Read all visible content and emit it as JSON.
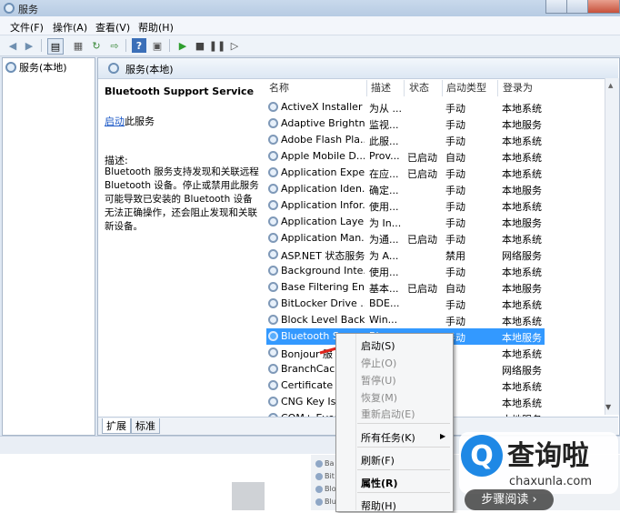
{
  "window": {
    "title": "服务"
  },
  "menu": [
    "文件(F)",
    "操作(A)",
    "查看(V)",
    "帮助(H)"
  ],
  "tree": {
    "root": "服务(本地)"
  },
  "panel": {
    "header": "服务(本地)",
    "service_title": "Bluetooth Support Service",
    "start_link": "启动",
    "start_suffix": "此服务",
    "desc_label": "描述:",
    "desc_text": "Bluetooth 服务支持发现和关联远程 Bluetooth 设备。停止或禁用此服务可能导致已安装的 Bluetooth 设备无法正确操作，还会阻止发现和关联新设备。"
  },
  "columns": [
    "名称",
    "描述",
    "状态",
    "启动类型",
    "登录为"
  ],
  "services": [
    {
      "name": "ActiveX Installer ...",
      "desc": "为从 ...",
      "status": "",
      "startup": "手动",
      "logon": "本地系统"
    },
    {
      "name": "Adaptive Brightn...",
      "desc": "监视...",
      "status": "",
      "startup": "手动",
      "logon": "本地服务"
    },
    {
      "name": "Adobe Flash Pla...",
      "desc": "此服...",
      "status": "",
      "startup": "手动",
      "logon": "本地系统"
    },
    {
      "name": "Apple Mobile D...",
      "desc": "Prov...",
      "status": "已启动",
      "startup": "自动",
      "logon": "本地系统"
    },
    {
      "name": "Application Expe...",
      "desc": "在应...",
      "status": "已启动",
      "startup": "手动",
      "logon": "本地系统"
    },
    {
      "name": "Application Iden...",
      "desc": "确定...",
      "status": "",
      "startup": "手动",
      "logon": "本地服务"
    },
    {
      "name": "Application Infor...",
      "desc": "使用...",
      "status": "",
      "startup": "手动",
      "logon": "本地系统"
    },
    {
      "name": "Application Laye...",
      "desc": "为 In...",
      "status": "",
      "startup": "手动",
      "logon": "本地服务"
    },
    {
      "name": "Application Man...",
      "desc": "为通...",
      "status": "已启动",
      "startup": "手动",
      "logon": "本地系统"
    },
    {
      "name": "ASP.NET 状态服务",
      "desc": "为 A...",
      "status": "",
      "startup": "禁用",
      "logon": "网络服务"
    },
    {
      "name": "Background Inte...",
      "desc": "使用...",
      "status": "",
      "startup": "手动",
      "logon": "本地系统"
    },
    {
      "name": "Base Filtering En...",
      "desc": "基本...",
      "status": "已启动",
      "startup": "自动",
      "logon": "本地服务"
    },
    {
      "name": "BitLocker Drive ...",
      "desc": "BDE...",
      "status": "",
      "startup": "手动",
      "logon": "本地系统"
    },
    {
      "name": "Block Level Back...",
      "desc": "Win...",
      "status": "",
      "startup": "手动",
      "logon": "本地系统"
    },
    {
      "name": "Bluetooth S",
      "desc": "Bl",
      "status": "",
      "startup": "手动",
      "logon": "本地服务"
    },
    {
      "name": "Bonjour 服",
      "desc": "",
      "status": "",
      "startup": "",
      "logon": "本地系统"
    },
    {
      "name": "BranchCach",
      "desc": "",
      "status": "",
      "startup": "",
      "logon": "网络服务"
    },
    {
      "name": "Certificate P",
      "desc": "",
      "status": "",
      "startup": "",
      "logon": "本地系统"
    },
    {
      "name": "CNG Key Is",
      "desc": "",
      "status": "",
      "startup": "",
      "logon": "本地系统"
    },
    {
      "name": "COM+ Ever",
      "desc": "",
      "status": "",
      "startup": "",
      "logon": "本地服务"
    }
  ],
  "selected_index": 14,
  "tabs": [
    "扩展",
    "标准"
  ],
  "context_menu": {
    "start": "启动(S)",
    "stop": "停止(O)",
    "pause": "暂停(U)",
    "resume": "恢复(M)",
    "restart": "重新启动(E)",
    "all_tasks": "所有任务(K)",
    "refresh": "刷新(F)",
    "properties": "属性(R)",
    "help": "帮助(H)"
  },
  "watermark": {
    "brand": "查询啦",
    "url": "chaxunla.com",
    "steps": "步骤阅读"
  },
  "colors": {
    "selection": "#3399ff",
    "link": "#1a57c6",
    "brand": "#1e88e5"
  }
}
